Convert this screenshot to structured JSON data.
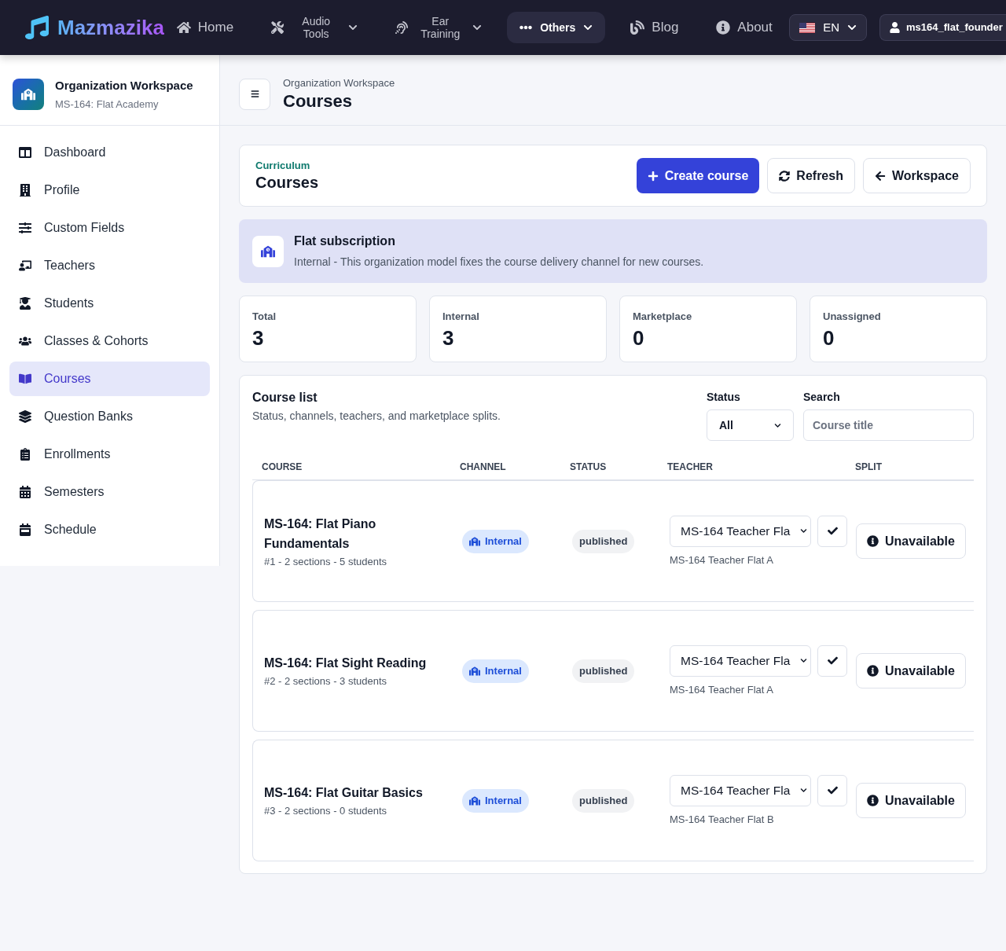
{
  "nav": {
    "brand": "Mazmazika",
    "items": [
      {
        "label": "Home",
        "kind": "link",
        "selected": false
      },
      {
        "label": "Audio Tools",
        "kind": "dropdown",
        "selected": false
      },
      {
        "label": "Ear Training",
        "kind": "dropdown",
        "selected": false
      },
      {
        "label": "Others",
        "kind": "dropdown",
        "selected": true
      },
      {
        "label": "Blog",
        "kind": "link",
        "selected": false
      },
      {
        "label": "About",
        "kind": "link",
        "selected": false
      }
    ],
    "language": "EN",
    "user": "ms164_flat_founder"
  },
  "sidebar": {
    "title": "Organization Workspace",
    "subtitle": "MS-164: Flat Academy",
    "items": [
      {
        "label": "Dashboard",
        "selected": false
      },
      {
        "label": "Profile",
        "selected": false
      },
      {
        "label": "Custom Fields",
        "selected": false
      },
      {
        "label": "Teachers",
        "selected": false
      },
      {
        "label": "Students",
        "selected": false
      },
      {
        "label": "Classes & Cohorts",
        "selected": false
      },
      {
        "label": "Courses",
        "selected": true
      },
      {
        "label": "Question Banks",
        "selected": false
      },
      {
        "label": "Enrollments",
        "selected": false
      },
      {
        "label": "Semesters",
        "selected": false
      },
      {
        "label": "Schedule",
        "selected": false
      }
    ]
  },
  "header": {
    "breadcrumb": "Organization Workspace",
    "title": "Courses"
  },
  "hero": {
    "eyebrow": "Curriculum",
    "title": "Courses",
    "buttons": [
      {
        "label": "Create course",
        "kind": "primary"
      },
      {
        "label": "Refresh",
        "kind": "refresh"
      },
      {
        "label": "Workspace",
        "kind": "back"
      }
    ]
  },
  "notice": {
    "title": "Flat subscription",
    "text": "Internal - This organization model fixes the course delivery channel for new courses."
  },
  "stats": [
    {
      "label": "Total",
      "value": "3"
    },
    {
      "label": "Internal",
      "value": "3"
    },
    {
      "label": "Marketplace",
      "value": "0"
    },
    {
      "label": "Unassigned",
      "value": "0"
    }
  ],
  "course_list": {
    "title": "Course list",
    "subtitle": "Status, channels, teachers, and marketplace splits.",
    "status_filter": {
      "label": "Status",
      "value": "All"
    },
    "search": {
      "label": "Search",
      "placeholder": "Course title"
    },
    "columns": [
      "COURSE",
      "CHANNEL",
      "STATUS",
      "TEACHER",
      "SPLIT"
    ],
    "rows": [
      {
        "title": "MS-164: Flat Piano Fundamentals",
        "meta": "#1 - 2 sections - 5 students",
        "channel": "Internal",
        "status": "published",
        "teacher_select": "MS-164 Teacher Fla",
        "teacher": "MS-164 Teacher Flat A",
        "split": "Unavailable"
      },
      {
        "title": "MS-164: Flat Sight Reading",
        "meta": "#2 - 2 sections - 3 students",
        "channel": "Internal",
        "status": "published",
        "teacher_select": "MS-164 Teacher Fla",
        "teacher": "MS-164 Teacher Flat A",
        "split": "Unavailable"
      },
      {
        "title": "MS-164: Flat Guitar Basics",
        "meta": "#3 - 2 sections - 0 students",
        "channel": "Internal",
        "status": "published",
        "teacher_select": "MS-164 Teacher Fla",
        "teacher": "MS-164 Teacher Flat B",
        "split": "Unavailable"
      }
    ]
  }
}
